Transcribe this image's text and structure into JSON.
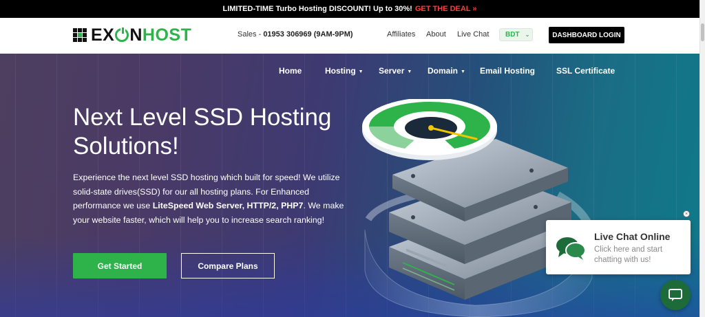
{
  "promo": {
    "text": "LIMITED-TIME Turbo Hosting DISCOUNT! Up to 30%!",
    "cta": "GET THE DEAL",
    "cta_arrow": "»"
  },
  "header": {
    "logo_text_left": "EX",
    "logo_text_right": "N",
    "logo_text_host": "HOST",
    "sales_label": "Sales -",
    "sales_phone": "01953 306969 (9AM-9PM)",
    "links": [
      "Affiliates",
      "About",
      "Live Chat"
    ],
    "currency": "BDT",
    "dashboard_button": "DASHBOARD LOGIN"
  },
  "nav": {
    "items": [
      {
        "label": "Home",
        "dropdown": false
      },
      {
        "label": "Hosting",
        "dropdown": true
      },
      {
        "label": "Server",
        "dropdown": true
      },
      {
        "label": "Domain",
        "dropdown": true
      },
      {
        "label": "Email Hosting",
        "dropdown": false
      },
      {
        "label": "SSL Certificate",
        "dropdown": false
      }
    ]
  },
  "hero": {
    "title": "Next Level SSD Hosting Solutions!",
    "desc_part1": "Experience the next level SSD hosting which built for speed! We utilize solid-state drives(SSD) for our all hosting plans. For Enhanced performance we use ",
    "desc_bold": "LiteSpeed Web Server, HTTP/2, PHP7",
    "desc_part2": ". We make your website faster, which will help you to increase search ranking!",
    "primary_button": "Get Started",
    "secondary_button": "Compare Plans"
  },
  "live_chat": {
    "title": "Live Chat Online",
    "subtitle": "Click here and start chatting with us!",
    "close_symbol": "×"
  },
  "colors": {
    "accent_green": "#2db34a",
    "promo_red": "#ff3b3b",
    "chat_fab": "#1e6b3a"
  },
  "icons": [
    "chat-bubbles-icon",
    "chat-icon",
    "close-icon",
    "chevron-down-icon",
    "speedometer-server-illustration"
  ]
}
